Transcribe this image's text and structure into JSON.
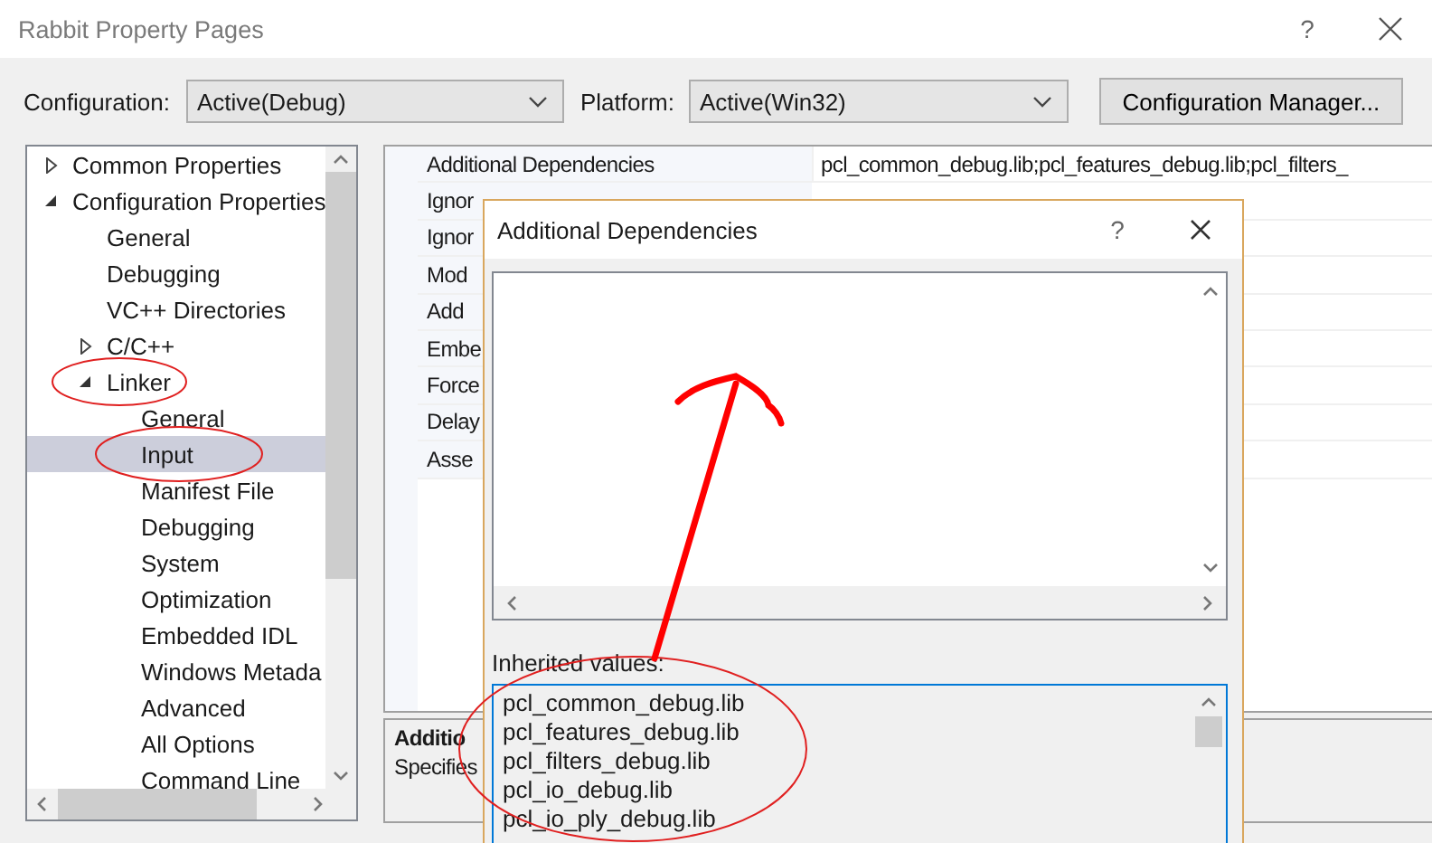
{
  "window": {
    "title": "Rabbit Property Pages",
    "help": "?"
  },
  "toolbar": {
    "configuration_label": "Configuration:",
    "configuration_value": "Active(Debug)",
    "platform_label": "Platform:",
    "platform_value": "Active(Win32)",
    "manager_button": "Configuration Manager..."
  },
  "tree": [
    {
      "label": "Common Properties",
      "expanded": false,
      "selected": false
    },
    {
      "label": "Configuration Properties",
      "expanded": true,
      "selected": false,
      "children": [
        {
          "label": "General",
          "selected": false
        },
        {
          "label": "Debugging",
          "selected": false
        },
        {
          "label": "VC++ Directories",
          "selected": false
        },
        {
          "label": "C/C++",
          "expanded": false,
          "selected": false
        },
        {
          "label": "Linker",
          "expanded": true,
          "selected": false,
          "children": [
            {
              "label": "General",
              "selected": false
            },
            {
              "label": "Input",
              "selected": true
            },
            {
              "label": "Manifest File",
              "selected": false
            },
            {
              "label": "Debugging",
              "selected": false
            },
            {
              "label": "System",
              "selected": false
            },
            {
              "label": "Optimization",
              "selected": false
            },
            {
              "label": "Embedded IDL",
              "selected": false
            },
            {
              "label": "Windows Metada",
              "selected": false
            },
            {
              "label": "Advanced",
              "selected": false
            },
            {
              "label": "All Options",
              "selected": false
            },
            {
              "label": "Command Line",
              "selected": false
            }
          ]
        }
      ]
    }
  ],
  "properties": [
    {
      "label": "Additional Dependencies",
      "value": "pcl_common_debug.lib;pcl_features_debug.lib;pcl_filters_"
    },
    {
      "label": "Ignor"
    },
    {
      "label": "Ignor"
    },
    {
      "label": "Mod"
    },
    {
      "label": "Add"
    },
    {
      "label": "Embe"
    },
    {
      "label": "Force"
    },
    {
      "label": "Delay"
    },
    {
      "label": "Asse"
    }
  ],
  "description": {
    "title": "Additio",
    "text": "Specifies"
  },
  "dialog": {
    "title": "Additional Dependencies",
    "help": "?",
    "inherited_label": "Inherited values:",
    "inherited_values": [
      "pcl_common_debug.lib",
      "pcl_features_debug.lib",
      "pcl_filters_debug.lib",
      "pcl_io_debug.lib",
      "pcl_io_ply_debug.lib"
    ]
  }
}
